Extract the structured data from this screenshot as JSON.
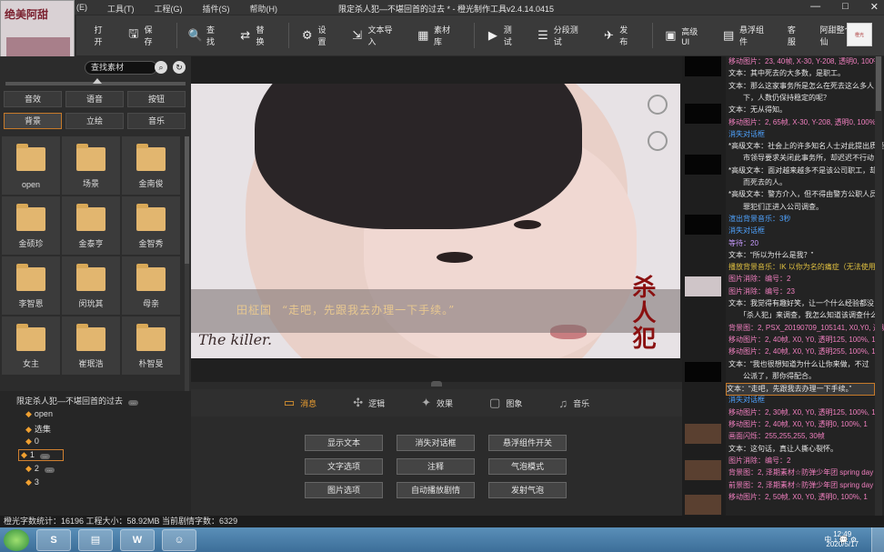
{
  "window": {
    "menus": [
      "(E)",
      "工具(T)",
      "工程(G)",
      "插件(S)",
      "帮助(H)"
    ],
    "title": "限定杀人犯—不堪回首的过去 * - 橙光制作工具v2.4.14.0415",
    "controls": [
      "—",
      "□",
      "✕"
    ]
  },
  "logo_left": {
    "text": "绝美阿甜"
  },
  "logo_right": {
    "text": "橙光"
  },
  "toolbar": {
    "items": [
      {
        "label": "打开",
        "icon": "folder-open-icon",
        "glyph": ""
      },
      {
        "label": "保存",
        "icon": "save-icon",
        "glyph": "🖫"
      },
      {
        "label": "查找",
        "icon": "search-icon",
        "glyph": "🔍"
      },
      {
        "label": "替换",
        "icon": "replace-icon",
        "glyph": "⇄"
      },
      {
        "label": "设置",
        "icon": "gear-icon",
        "glyph": "⚙"
      },
      {
        "label": "文本导入",
        "icon": "import-icon",
        "glyph": "⇲"
      },
      {
        "label": "素材库",
        "icon": "library-icon",
        "glyph": "▦"
      },
      {
        "label": "测试",
        "icon": "play-icon",
        "glyph": "▶"
      },
      {
        "label": "分段测试",
        "icon": "segment-test-icon",
        "glyph": "☰"
      },
      {
        "label": "发布",
        "icon": "publish-icon",
        "glyph": "✈"
      },
      {
        "label": "高级UI",
        "icon": "advanced-ui-icon",
        "glyph": "▣"
      },
      {
        "label": "悬浮组件",
        "icon": "float-widget-icon",
        "glyph": "▤"
      },
      {
        "label": "客服",
        "icon": "",
        "glyph": ""
      },
      {
        "label": "阿甜整个神仙",
        "icon": "",
        "glyph": ""
      }
    ]
  },
  "left": {
    "search_value": "查找素材",
    "categories": [
      {
        "label": "音效",
        "active": false
      },
      {
        "label": "语音",
        "active": false
      },
      {
        "label": "按钮",
        "active": false
      },
      {
        "label": "背景",
        "active": true
      },
      {
        "label": "立绘",
        "active": false
      },
      {
        "label": "音乐",
        "active": false
      }
    ],
    "folders": [
      "open",
      "场景",
      "金南俊",
      "金硕珍",
      "金泰亨",
      "金智秀",
      "李智恩",
      "闵玧其",
      "母亲",
      "女主",
      "崔珉浩",
      "朴智旻"
    ],
    "tree": {
      "root": "限定杀人犯—不堪回首的过去",
      "root_badge": "...",
      "items": [
        {
          "label": "open",
          "badge": "",
          "selected": false
        },
        {
          "label": "选集",
          "badge": "",
          "selected": false
        },
        {
          "label": "0",
          "badge": "",
          "selected": false
        },
        {
          "label": "1",
          "badge": "...",
          "selected": true
        },
        {
          "label": "2",
          "badge": "...",
          "selected": false
        },
        {
          "label": "3",
          "badge": "",
          "selected": false
        }
      ]
    }
  },
  "preview": {
    "speaker": "田柾国",
    "line": "“走吧，先跟我去办理一下手续。”",
    "caption_en": "The killer.",
    "title_cn": "杀人犯"
  },
  "tabs": [
    {
      "label": "消息",
      "icon": "message-icon",
      "glyph": "▭",
      "active": true
    },
    {
      "label": "逻辑",
      "icon": "logic-icon",
      "glyph": "✣",
      "active": false
    },
    {
      "label": "效果",
      "icon": "effects-icon",
      "glyph": "✦",
      "active": false
    },
    {
      "label": "图象",
      "icon": "image-icon",
      "glyph": "▢",
      "active": false
    },
    {
      "label": "音乐",
      "icon": "music-icon",
      "glyph": "♫",
      "active": false
    }
  ],
  "actions": [
    "显示文本",
    "消失对话框",
    "悬浮组件开关",
    "文字选项",
    "注释",
    "气泡模式",
    "图片选项",
    "自动播放剧情",
    "发射气泡"
  ],
  "log": [
    {
      "text": "移动图片：23, 40帧, X-30, Y-208, 透明0, 100%",
      "c": "pink"
    },
    {
      "text": "文本：其中死去的大多数，是职工。",
      "c": "white"
    },
    {
      "text": "文本：那么这家事务所是怎么在死去这么多人",
      "c": "white"
    },
    {
      "text": "　　下，人数仍保持稳定的呢？",
      "c": "white"
    },
    {
      "text": "文本：无从得知。",
      "c": "white"
    },
    {
      "text": "移动图片：2, 65帧, X-30, Y-208, 透明0, 100%",
      "c": "pink"
    },
    {
      "text": "消失对话框",
      "c": "blue"
    },
    {
      "text": "*高级文本：社会上的许多知名人士对此提出质疑",
      "c": "white"
    },
    {
      "text": "　　市领导要求关闭此事务所，却迟迟不行动",
      "c": "white"
    },
    {
      "text": "*高级文本：面对越来越多不是该公司职工，却",
      "c": "white"
    },
    {
      "text": "　　而死去的人。",
      "c": "white"
    },
    {
      "text": "*高级文本：警方介入，但不得由警方公职人员",
      "c": "white"
    },
    {
      "text": "　　罪犯们正进入公司调查。",
      "c": "white"
    },
    {
      "text": "渲出背景音乐：3秒",
      "c": "blue"
    },
    {
      "text": "消失对话框",
      "c": "blue"
    },
    {
      "text": "等待：20",
      "c": "purple"
    },
    {
      "text": "文本：“所以为什么是我？”",
      "c": "white"
    },
    {
      "text": "播放背景音乐：IK 以你为名的痛症（无法使用）",
      "c": "gold"
    },
    {
      "text": "图片消除：编号：2",
      "c": "pink"
    },
    {
      "text": "图片消除：编号：23",
      "c": "pink"
    },
    {
      "text": "文本：我觉得有趣好笑，让一个什么经验都没",
      "c": "white"
    },
    {
      "text": "　　「杀人犯」来调查，我怎么知道该调查什么",
      "c": "white"
    },
    {
      "text": "背景图：2, PSX_20190709_105141, X0,Y0, 透明",
      "c": "pink"
    },
    {
      "text": "移动图片：2, 40帧, X0, Y0, 透明125, 100%, 1",
      "c": "pink"
    },
    {
      "text": "移动图片：2, 40帧, X0, Y0, 透明255, 100%, 1",
      "c": "pink"
    },
    {
      "text": "文本：“我也很想知道为什么让你来做，不过",
      "c": "white"
    },
    {
      "text": "　　公派了，那你得配合。",
      "c": "white"
    },
    {
      "text": "文本：“走吧，先跟我去办理一下手续。”",
      "c": "white",
      "hl": true
    },
    {
      "text": "消失对话框",
      "c": "blue"
    },
    {
      "text": "移动图片：2, 30帧, X0, Y0, 透明125, 100%, 1",
      "c": "pink"
    },
    {
      "text": "移动图片：2, 40帧, X0, Y0, 透明0, 100%, 1",
      "c": "pink"
    },
    {
      "text": "画面闪烁：255,255,255, 30帧",
      "c": "pink"
    },
    {
      "text": "文本：这句话，真让人撕心裂怀。",
      "c": "white"
    },
    {
      "text": "图片消除：编号：2",
      "c": "pink"
    },
    {
      "text": "背景图：2, 泽期素材☆防弹少年团 spring day",
      "c": "pink"
    },
    {
      "text": "前景图：2, 泽期素材☆防弹少年团 spring day",
      "c": "pink"
    },
    {
      "text": "移动图片：2, 50帧, X0, Y0, 透明0, 100%, 1",
      "c": "pink"
    }
  ],
  "status": "橙光字数统计：16196 工程大小：58.92MB 当前剧情字数：6329",
  "taskbar": {
    "apps": [
      "S",
      "▤",
      "W",
      "☺"
    ],
    "tray": "中 ♪ 💬 ⚙",
    "time": "12:49",
    "date": "2020/5/17"
  }
}
